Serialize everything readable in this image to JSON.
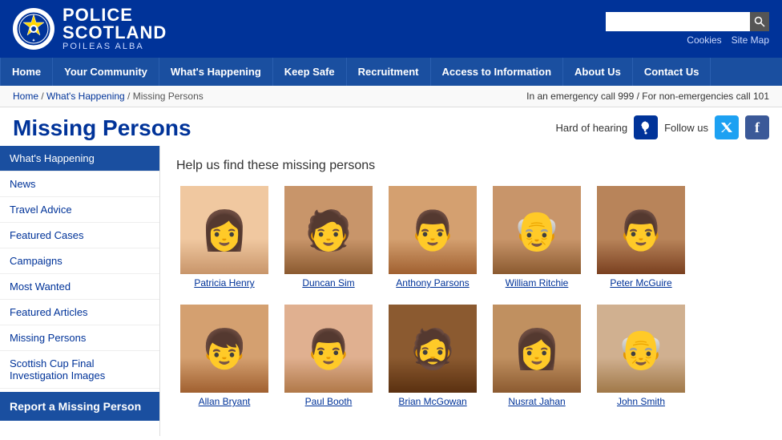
{
  "header": {
    "logo_police": "POLICE",
    "logo_scotland": "SCOTLAND",
    "logo_gaelic": "POILEAS ALBA",
    "search_placeholder": "",
    "link_cookies": "Cookies",
    "link_sitemap": "Site Map"
  },
  "nav": {
    "items": [
      {
        "label": "Home",
        "active": false
      },
      {
        "label": "Your Community",
        "active": false
      },
      {
        "label": "What's Happening",
        "active": false
      },
      {
        "label": "Keep Safe",
        "active": false
      },
      {
        "label": "Recruitment",
        "active": false
      },
      {
        "label": "Access to Information",
        "active": false
      },
      {
        "label": "About Us",
        "active": false
      },
      {
        "label": "Contact Us",
        "active": false
      }
    ]
  },
  "breadcrumb": {
    "items": [
      "Home",
      "What's Happening",
      "Missing Persons"
    ],
    "emergency": "In an emergency call 999 / For non-emergencies call 101"
  },
  "page": {
    "title": "Missing Persons",
    "subtitle": "Help us find these missing persons",
    "hard_of_hearing": "Hard of hearing",
    "follow_us": "Follow us"
  },
  "sidebar": {
    "items": [
      {
        "label": "What's Happening",
        "active": true
      },
      {
        "label": "News",
        "active": false
      },
      {
        "label": "Travel Advice",
        "active": false
      },
      {
        "label": "Featured Cases",
        "active": false
      },
      {
        "label": "Campaigns",
        "active": false
      },
      {
        "label": "Most Wanted",
        "active": false
      },
      {
        "label": "Featured Articles",
        "active": false
      },
      {
        "label": "Missing Persons",
        "active": false
      },
      {
        "label": "Scottish Cup Final Investigation Images",
        "active": false
      }
    ],
    "report_label": "Report a Missing Person"
  },
  "persons": {
    "row1": [
      {
        "name": "Patricia Henry",
        "photo_class": "photo-patricia"
      },
      {
        "name": "Duncan Sim",
        "photo_class": "photo-duncan"
      },
      {
        "name": "Anthony Parsons",
        "photo_class": "photo-anthony"
      },
      {
        "name": "William Ritchie",
        "photo_class": "photo-william"
      },
      {
        "name": "Peter McGuire",
        "photo_class": "photo-peter"
      }
    ],
    "row2": [
      {
        "name": "Allan Bryant",
        "photo_class": "photo-allan"
      },
      {
        "name": "Paul Booth",
        "photo_class": "photo-paul"
      },
      {
        "name": "Brian McGowan",
        "photo_class": "photo-brian"
      },
      {
        "name": "Nusrat Jahan",
        "photo_class": "photo-nusrat"
      },
      {
        "name": "John Smith",
        "photo_class": "photo-john"
      }
    ]
  },
  "icons": {
    "search": "🔍",
    "hearing": "🦻",
    "twitter": "𝕏",
    "facebook": "f"
  }
}
